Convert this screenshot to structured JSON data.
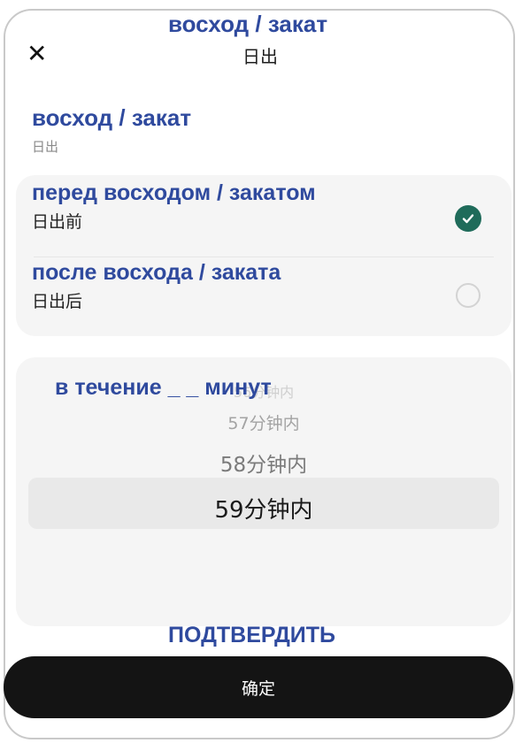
{
  "header": {
    "title_overlay": "восход / закат",
    "title": "日出",
    "close_glyph": "✕"
  },
  "section": {
    "label_overlay": "восход / закат",
    "label": "日出"
  },
  "options": [
    {
      "overlay": "перед восходом / закатом",
      "label": "日出前",
      "selected": true
    },
    {
      "overlay": "после восхода / заката",
      "label": "日出后",
      "selected": false
    }
  ],
  "picker": {
    "overlay": "в течение _ _ минут",
    "faded_top": "56分钟内",
    "items": [
      "57分钟内",
      "58分钟内",
      "59分钟内"
    ],
    "selected_index": 2
  },
  "confirm": {
    "overlay": "ПОДТВЕРДИТЬ",
    "label": "确定"
  },
  "colors": {
    "accent": "#1f6b5a",
    "overlay_text": "#2f4a9e",
    "button_bg": "#141414"
  },
  "icons": {
    "close": "close-icon",
    "check": "check-icon"
  }
}
